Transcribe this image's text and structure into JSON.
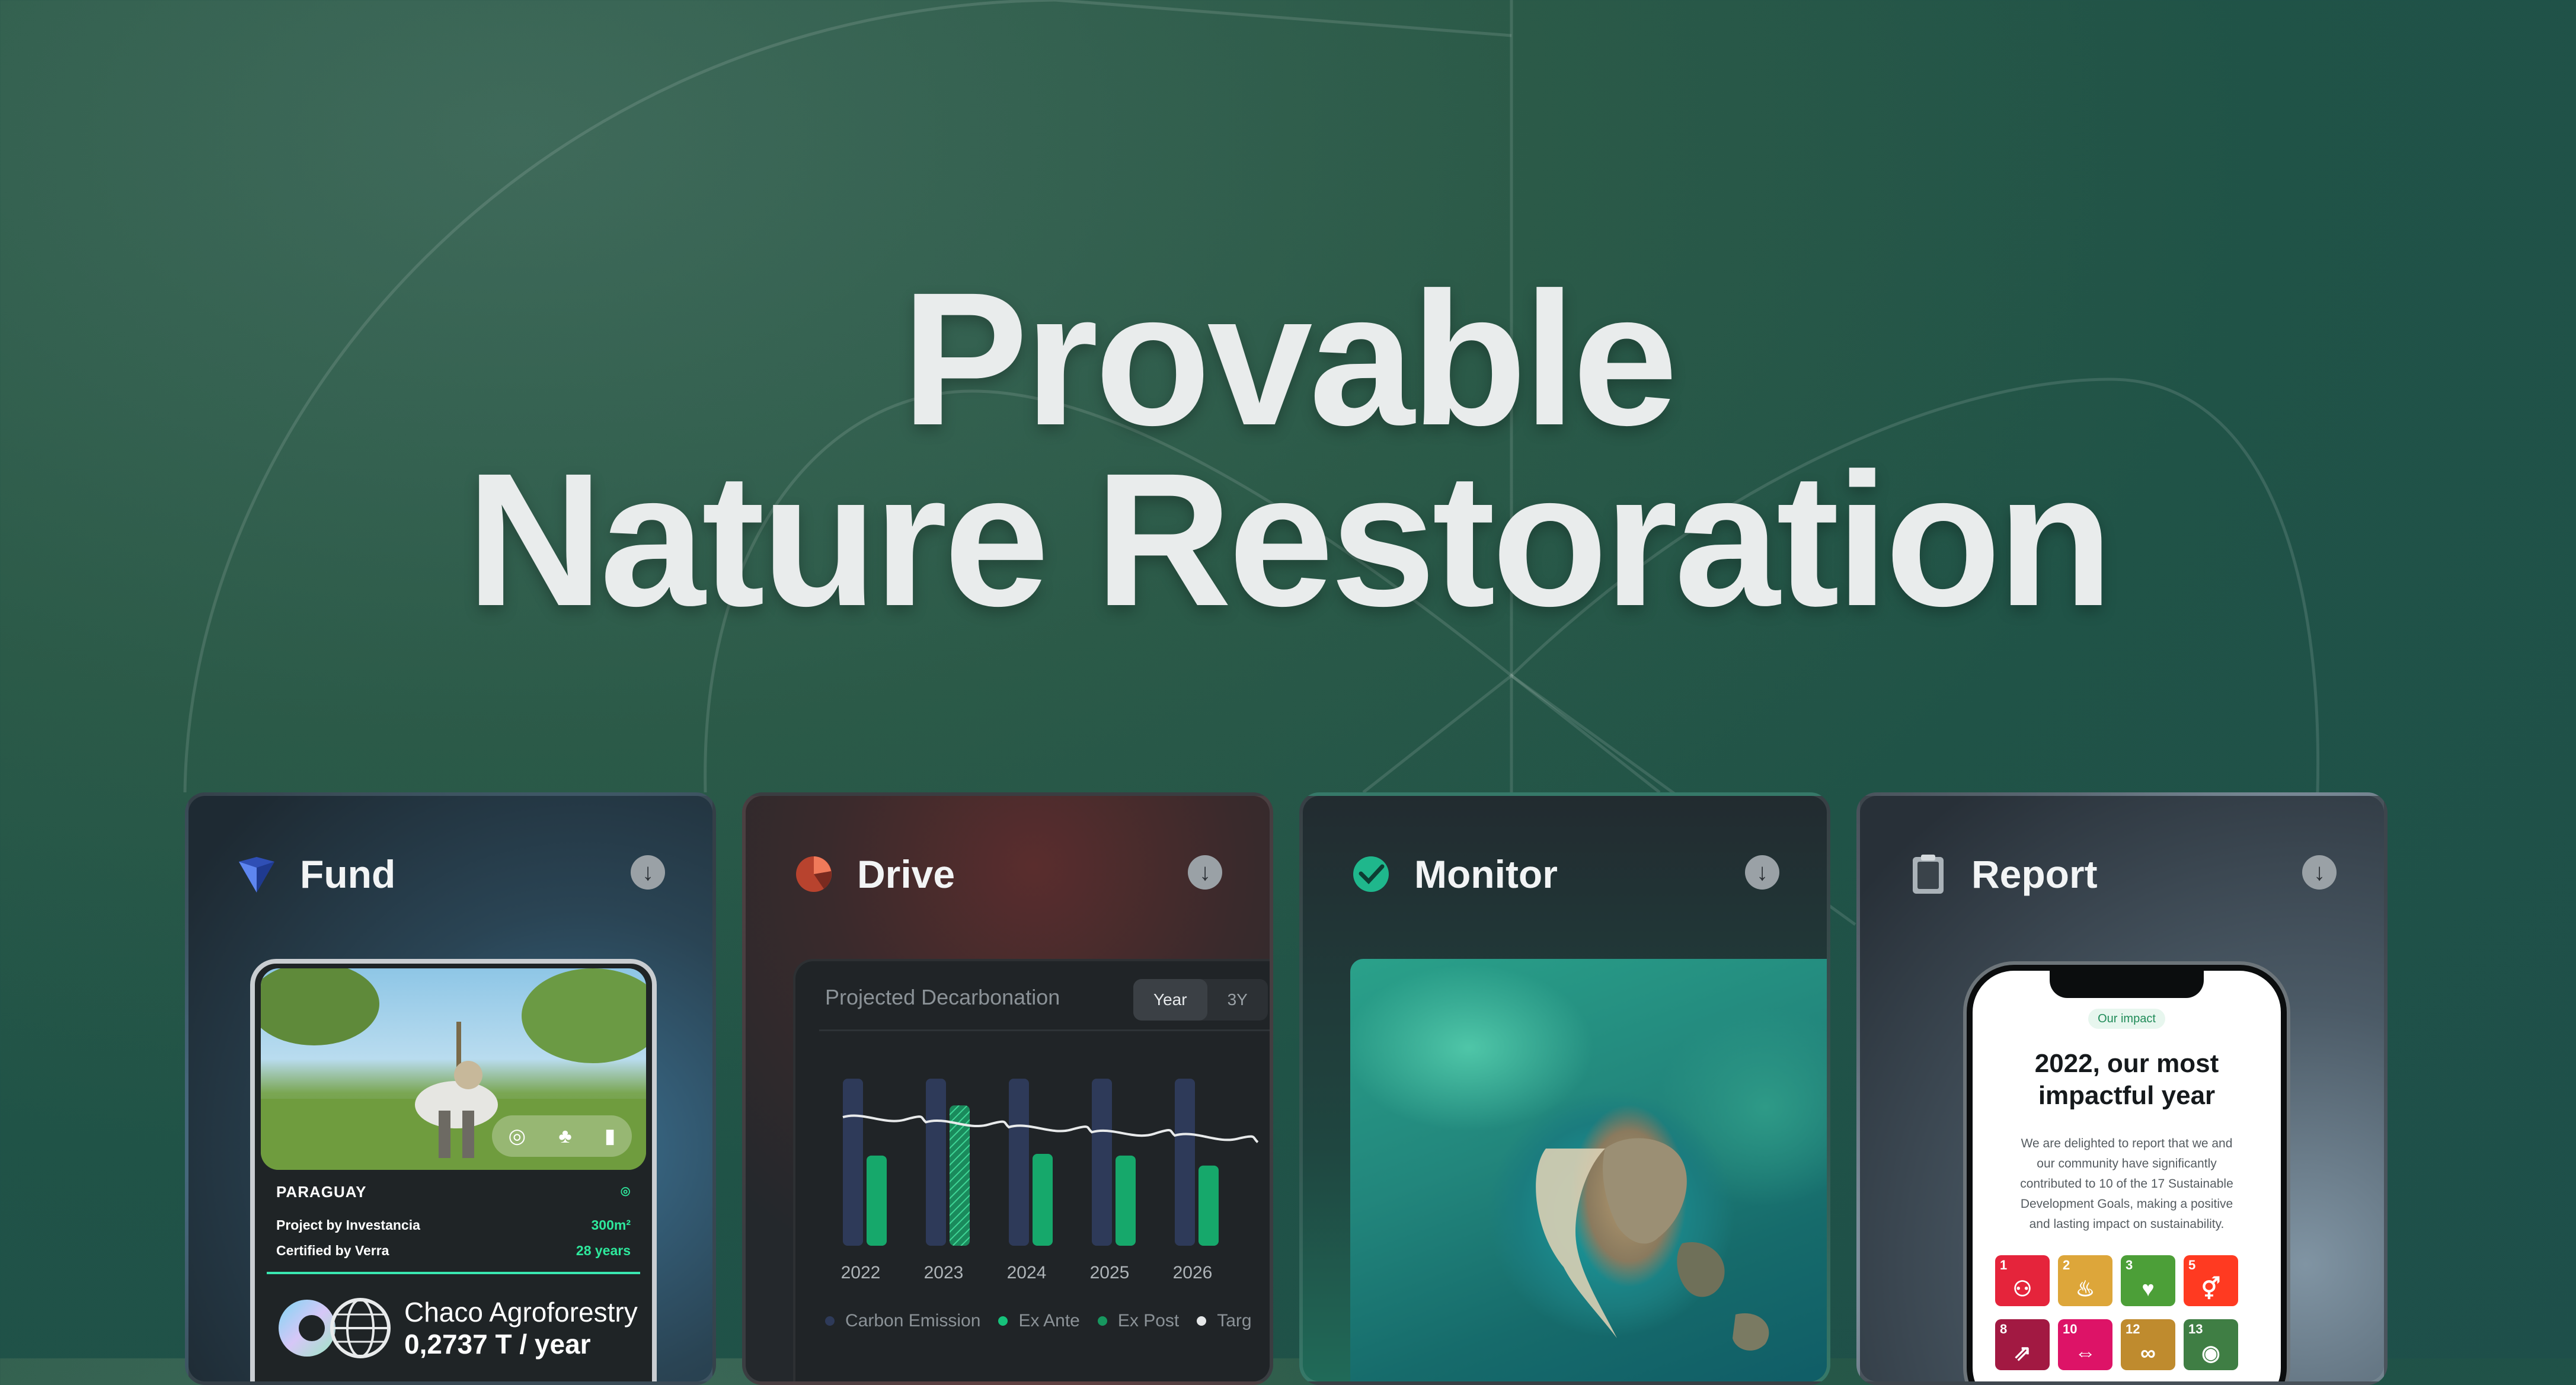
{
  "hero": {
    "line1": "Provable",
    "line2": "Nature Restoration"
  },
  "cards": [
    {
      "title": "Fund",
      "icon": "diamond-logo-icon"
    },
    {
      "title": "Drive",
      "icon": "pie-chart-icon"
    },
    {
      "title": "Monitor",
      "icon": "check-circle-icon"
    },
    {
      "title": "Report",
      "icon": "clipboard-icon"
    }
  ],
  "fund": {
    "country": "PARAGUAY",
    "project_by": "Project by Investancia",
    "area": "300m²",
    "certified_by": "Certified by Verra",
    "duration": "28 years",
    "name": "Chaco Agroforestry",
    "rate": "0,2737 T / year"
  },
  "drive": {
    "heading": "Projected Decarbonation",
    "tabs": [
      "Year",
      "3Y"
    ],
    "legend": [
      "Carbon Emission",
      "Ex Ante",
      "Ex Post",
      "Targ"
    ]
  },
  "report": {
    "pill": "Our impact",
    "title_l1": "2022, our most",
    "title_l2": "impactful year",
    "body_l1": "We are delighted to report that we and",
    "body_l2": "our community have significantly",
    "body_l3": "contributed to 10 of the 17 Sustainable",
    "body_l4": "Development Goals, making a positive",
    "body_l5": "and lasting impact on sustainability.",
    "sdgs": [
      {
        "num": "1",
        "color": "#e5243b"
      },
      {
        "num": "2",
        "color": "#dda63a"
      },
      {
        "num": "3",
        "color": "#4c9f38"
      },
      {
        "num": "5",
        "color": "#ff3a21"
      },
      {
        "num": "8",
        "color": "#a21942"
      },
      {
        "num": "10",
        "color": "#dd1367"
      },
      {
        "num": "12",
        "color": "#bf8b2e"
      },
      {
        "num": "13",
        "color": "#3f7e44"
      }
    ]
  },
  "chart_data": {
    "type": "bar",
    "categories": [
      "2022",
      "2023",
      "2024",
      "2025",
      "2026"
    ],
    "series": [
      {
        "name": "Carbon Emission",
        "values": [
          100,
          100,
          100,
          100,
          100
        ],
        "color": "#2e3a59"
      },
      {
        "name": "Ex Ante",
        "values": [
          54,
          84,
          55,
          54,
          48
        ],
        "color": "#16a86b"
      },
      {
        "name": "Ex Post",
        "values": [
          null,
          84,
          null,
          null,
          null
        ],
        "color": "#1a7a56"
      }
    ],
    "target_line": [
      77,
      74,
      71,
      68,
      66,
      62
    ],
    "ylim": [
      0,
      110
    ],
    "legend_position": "bottom"
  }
}
